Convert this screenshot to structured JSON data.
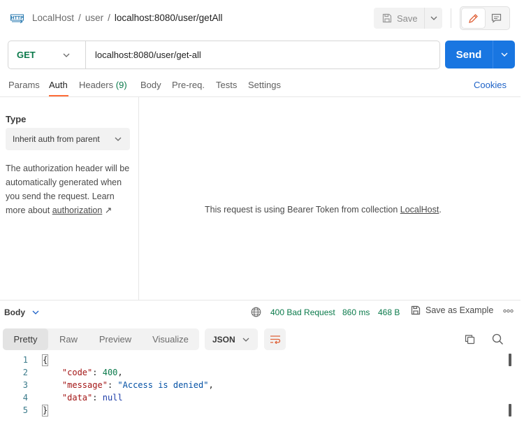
{
  "breadcrumb": {
    "workspace": "LocalHost",
    "separator": "/",
    "folder": "user",
    "current": "localhost:8080/user/getAll"
  },
  "toolbar": {
    "save_label": "Save"
  },
  "request": {
    "method": "GET",
    "url": "localhost:8080/user/get-all",
    "send_label": "Send"
  },
  "request_tabs": {
    "params": "Params",
    "auth": "Auth",
    "headers": "Headers",
    "headers_count": "(9)",
    "body": "Body",
    "prereq": "Pre-req.",
    "tests": "Tests",
    "settings": "Settings",
    "cookies": "Cookies",
    "active": "Auth"
  },
  "auth": {
    "type_label": "Type",
    "type_value": "Inherit auth from parent",
    "description": "The authorization header will be automatically generated when you send the request. Learn more about ",
    "link_text": "authorization",
    "link_arrow": "↗",
    "message_prefix": "This request is using Bearer Token from collection ",
    "message_collection": "LocalHost",
    "message_suffix": "."
  },
  "response": {
    "body_label": "Body",
    "status": "400 Bad Request",
    "time": "860 ms",
    "size": "468 B",
    "save_example_label": "Save as Example",
    "view_tabs": [
      "Pretty",
      "Raw",
      "Preview",
      "Visualize"
    ],
    "active_view": "Pretty",
    "format": "JSON",
    "lines": [
      "1",
      "2",
      "3",
      "4",
      "5"
    ],
    "code": {
      "open": "{",
      "k1": "\"code\"",
      "v1": "400",
      "k2": "\"message\"",
      "v2": "\"Access is denied\"",
      "k3": "\"data\"",
      "v3": "null",
      "close": "}"
    }
  },
  "colors": {
    "accent_orange": "#ff6c37",
    "send_blue": "#1976e1",
    "method_green": "#0b7a4b",
    "status_green": "#0b7a4b",
    "link_blue": "#1d62c7"
  },
  "icons": [
    "http-icon",
    "save-icon",
    "chevron-down-icon",
    "pencil-icon",
    "comment-icon",
    "globe-icon",
    "more-icon",
    "wrap-icon",
    "copy-icon",
    "search-icon"
  ]
}
